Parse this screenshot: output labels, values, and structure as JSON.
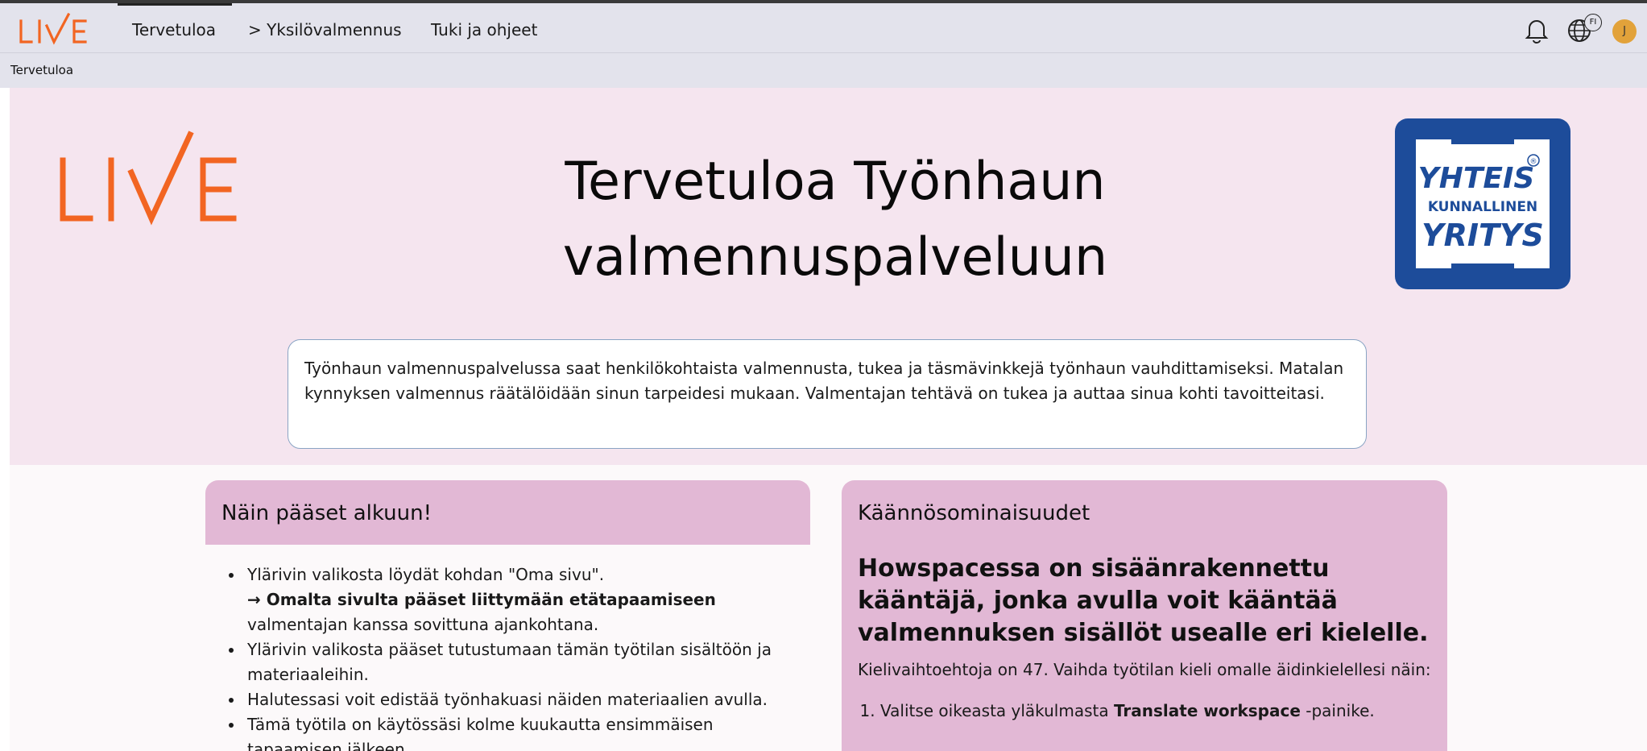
{
  "nav": {
    "logo_text": "LIVE",
    "items": [
      {
        "label": "Tervetuloa"
      },
      {
        "label": "Yksilövalmennus",
        "prefix": ">"
      },
      {
        "label": "Tuki ja ohjeet"
      }
    ],
    "language_badge": "FI",
    "avatar_initial": "J"
  },
  "breadcrumb": {
    "label": "Tervetuloa"
  },
  "hero": {
    "logo_text": "LIVE",
    "title_line1": "Tervetuloa Työnhaun",
    "title_line2": "valmennuspalveluun",
    "emblem": {
      "line1": "YHTEIS",
      "line2": "KUNNALLINEN",
      "line3": "YRITYS",
      "mark": "®"
    },
    "intro": "Työnhaun valmennuspalvelussa saat henkilökohtaista valmennusta, tukea ja täsmävinkkejä työnhaun vauhdittamiseksi. Matalan kynnyksen valmennus räätälöidään sinun tarpeidesi mukaan. Valmentajan tehtävä on tukea ja auttaa sinua kohti tavoitteitasi."
  },
  "start_card": {
    "title": "Näin pääset alkuun!",
    "item1": "Ylärivin valikosta löydät kohdan \"Oma sivu\".",
    "item1_bold": "→ Omalta sivulta pääset liittymään etätapaamiseen",
    "item1_rest": "valmentajan kanssa sovittuna ajankohtana.",
    "item2": "Ylärivin valikosta pääset tutustumaan tämän työtilan sisältöön ja materiaaleihin.",
    "item3": "Halutessasi voit edistää työnhakuasi näiden materiaalien avulla.",
    "item4": "Tämä työtila on käytössäsi kolme kuukautta ensimmäisen tapaamisen jälkeen."
  },
  "translate_card": {
    "title": "Käännösominaisuudet",
    "subtitle": "Howspacessa on sisäänrakennettu kääntäjä, jonka avulla voit kääntää valmennuksen sisällöt usealle eri kielelle.",
    "paragraph": "Kielivaihtoehtoja on 47. Vaihda työtilan kieli omalle äidinkielellesi näin:",
    "step1_pre": "Valitse oikeasta yläkulmasta ",
    "step1_bold": "Translate workspace",
    "step1_post": " -painike."
  },
  "colors": {
    "brand_orange": "#f26522",
    "emblem_blue": "#1d4c9a",
    "hero_bg": "#f5e5ef",
    "card_header": "#e2b8d5",
    "nav_bg": "#e3e3ec"
  }
}
